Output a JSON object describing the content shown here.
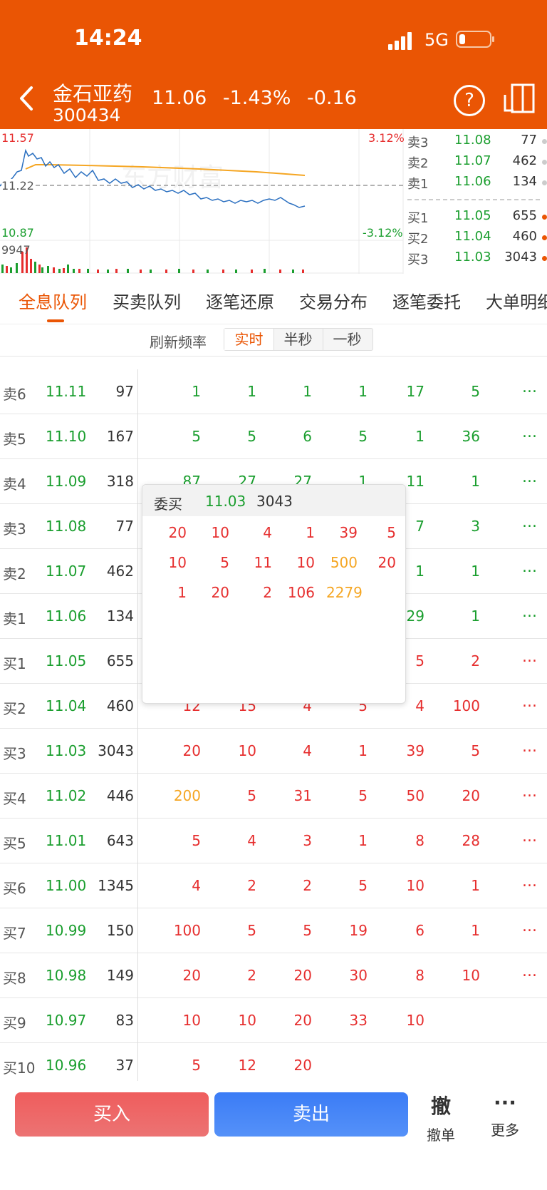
{
  "status_bar": {
    "time": "14:24",
    "network": "5G"
  },
  "header": {
    "name": "金石亚药",
    "code": "300434",
    "price": "11.06",
    "change_pct": "-1.43%",
    "change": "-0.16"
  },
  "chart": {
    "high": "11.57",
    "prev": "11.22",
    "low": "10.87",
    "pct_up": "3.12%",
    "pct_down": "-3.12%",
    "volume_max": "9947",
    "watermark": "东方财富"
  },
  "orderbook": [
    {
      "label": "卖3",
      "price": "11.08",
      "vol": "77"
    },
    {
      "label": "卖2",
      "price": "11.07",
      "vol": "462"
    },
    {
      "label": "卖1",
      "price": "11.06",
      "vol": "134"
    },
    {
      "label": "买1",
      "price": "11.05",
      "vol": "655"
    },
    {
      "label": "买2",
      "price": "11.04",
      "vol": "460"
    },
    {
      "label": "买3",
      "price": "11.03",
      "vol": "3043"
    }
  ],
  "tabs": [
    "全息队列",
    "买卖队列",
    "逐笔还原",
    "交易分布",
    "逐笔委托",
    "大单明细"
  ],
  "refresh": {
    "label": "刷新频率",
    "options": [
      "实时",
      "半秒",
      "一秒"
    ]
  },
  "rows": [
    {
      "level": "卖6",
      "price": "11.11",
      "vol": "97",
      "q": [
        "1",
        "1",
        "1",
        "1",
        "17",
        "5"
      ],
      "more": "..."
    },
    {
      "level": "卖5",
      "price": "11.10",
      "vol": "167",
      "q": [
        "5",
        "5",
        "6",
        "5",
        "1",
        "36"
      ],
      "more": "..."
    },
    {
      "level": "卖4",
      "price": "11.09",
      "vol": "318",
      "q": [
        "87",
        "27",
        "27",
        "1",
        "11",
        "1"
      ],
      "more": "..."
    },
    {
      "level": "卖3",
      "price": "11.08",
      "vol": "77",
      "q": [
        "",
        "",
        "",
        "",
        "7",
        "3"
      ],
      "more": "..."
    },
    {
      "level": "卖2",
      "price": "11.07",
      "vol": "462",
      "q": [
        "",
        "",
        "",
        "",
        "1",
        "1"
      ],
      "more": "..."
    },
    {
      "level": "卖1",
      "price": "11.06",
      "vol": "134",
      "q": [
        "",
        "",
        "",
        "",
        "29",
        "1"
      ],
      "more": "..."
    },
    {
      "level": "买1",
      "price": "11.05",
      "vol": "655",
      "q": [
        "",
        "",
        "",
        "",
        "5",
        "2"
      ],
      "more": "..."
    },
    {
      "level": "买2",
      "price": "11.04",
      "vol": "460",
      "q": [
        "12",
        "15",
        "4",
        "5",
        "4",
        "100"
      ],
      "more": "..."
    },
    {
      "level": "买3",
      "price": "11.03",
      "vol": "3043",
      "q": [
        "20",
        "10",
        "4",
        "1",
        "39",
        "5"
      ],
      "more": "..."
    },
    {
      "level": "买4",
      "price": "11.02",
      "vol": "446",
      "q": [
        "200",
        "5",
        "31",
        "5",
        "50",
        "20"
      ],
      "more": "..."
    },
    {
      "level": "买5",
      "price": "11.01",
      "vol": "643",
      "q": [
        "5",
        "4",
        "3",
        "1",
        "8",
        "28"
      ],
      "more": "..."
    },
    {
      "level": "买6",
      "price": "11.00",
      "vol": "1345",
      "q": [
        "4",
        "2",
        "2",
        "5",
        "10",
        "1"
      ],
      "more": "..."
    },
    {
      "level": "买7",
      "price": "10.99",
      "vol": "150",
      "q": [
        "100",
        "5",
        "5",
        "19",
        "6",
        "1"
      ],
      "more": "..."
    },
    {
      "level": "买8",
      "price": "10.98",
      "vol": "149",
      "q": [
        "20",
        "2",
        "20",
        "30",
        "8",
        "10"
      ],
      "more": "..."
    },
    {
      "level": "买9",
      "price": "10.97",
      "vol": "83",
      "q": [
        "10",
        "10",
        "20",
        "33",
        "10",
        ""
      ],
      "more": ""
    },
    {
      "level": "买10",
      "price": "10.96",
      "vol": "37",
      "q": [
        "5",
        "12",
        "20",
        "",
        "",
        ""
      ],
      "more": ""
    }
  ],
  "popup": {
    "title": "委买",
    "price": "11.03",
    "vol": "3043",
    "lines": [
      [
        "20",
        "10",
        "4",
        "1",
        "39",
        "5"
      ],
      [
        "10",
        "5",
        "11",
        "10",
        "500",
        "20"
      ],
      [
        "1",
        "20",
        "2",
        "106",
        "2279",
        ""
      ]
    ]
  },
  "bottom": {
    "buy": "买入",
    "sell": "卖出",
    "cancel_big": "撤",
    "cancel_small": "撤单",
    "more_big": "···",
    "more_small": "更多"
  },
  "colors": {
    "accent": "#ea5504",
    "up": "#e62e2e",
    "down": "#1a9e2e",
    "big_order": "#f5a623",
    "buy_button": "#ef5d5d",
    "sell_button": "#3b7cf6"
  }
}
